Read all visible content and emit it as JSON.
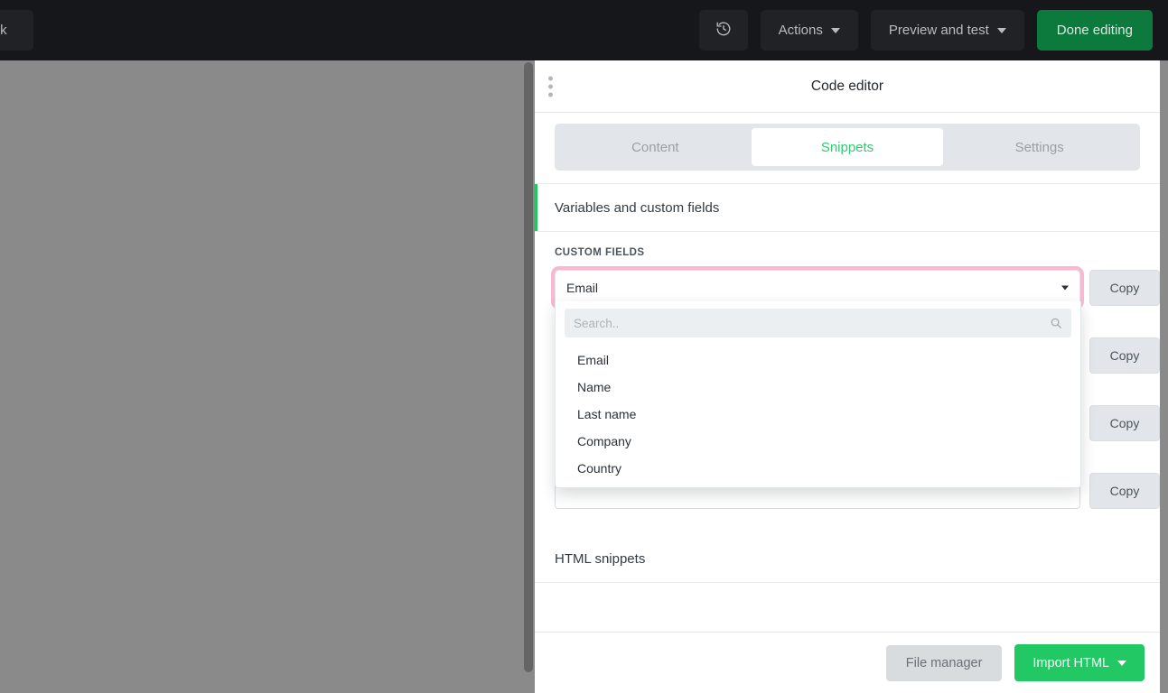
{
  "topbar": {
    "back_label": "Back",
    "history_icon": "history-clock-icon",
    "actions_label": "Actions",
    "preview_label": "Preview and test",
    "done_label": "Done editing",
    "green_color": "#0c7a3d"
  },
  "panel": {
    "title": "Code editor",
    "drag_handle_icon": "drag-dots-icon",
    "tabs": [
      {
        "label": "Content",
        "active": false
      },
      {
        "label": "Snippets",
        "active": true
      },
      {
        "label": "Settings",
        "active": false
      }
    ],
    "active_tab_color": "#2ecc6f",
    "sections": [
      {
        "label": "Variables and custom fields",
        "accent": true,
        "accent_color": "#23c661"
      },
      {
        "label": "HTML snippets",
        "accent": false
      }
    ],
    "custom_fields": {
      "label": "CUSTOM FIELDS",
      "selected_value": "Email",
      "focus_ring_color": "#f7b8d2",
      "copy_label": "Copy",
      "rows": [
        {
          "value": "Email",
          "copy_label": "Copy"
        },
        {
          "value": "",
          "copy_label": "Copy"
        },
        {
          "value": "",
          "copy_label": "Copy"
        },
        {
          "value": "",
          "copy_label": "Copy"
        }
      ]
    },
    "dropdown": {
      "search_placeholder": "Search..",
      "search_value": "",
      "search_icon": "search-icon",
      "options": [
        "Email",
        "Name",
        "Last name",
        "Company",
        "Country"
      ]
    },
    "footer": {
      "file_manager_label": "File manager",
      "import_label": "Import HTML",
      "import_color": "#22c863"
    }
  }
}
